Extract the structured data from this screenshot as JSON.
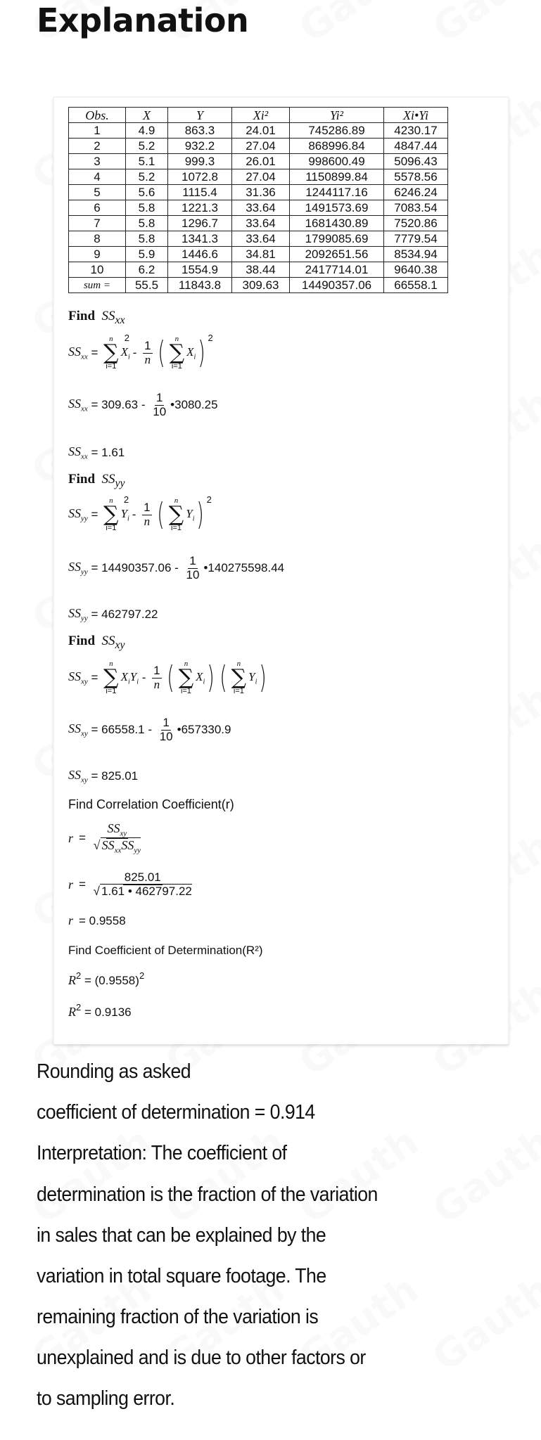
{
  "header": {
    "title": "Explanation"
  },
  "table": {
    "columns": [
      "Obs.",
      "X",
      "Y",
      "Xi²",
      "Yi²",
      "Xi•Yi"
    ],
    "rows": [
      [
        "1",
        "4.9",
        "863.3",
        "24.01",
        "745286.89",
        "4230.17"
      ],
      [
        "2",
        "5.2",
        "932.2",
        "27.04",
        "868996.84",
        "4847.44"
      ],
      [
        "3",
        "5.1",
        "999.3",
        "26.01",
        "998600.49",
        "5096.43"
      ],
      [
        "4",
        "5.2",
        "1072.8",
        "27.04",
        "1150899.84",
        "5578.56"
      ],
      [
        "5",
        "5.6",
        "1115.4",
        "31.36",
        "1244117.16",
        "6246.24"
      ],
      [
        "6",
        "5.8",
        "1221.3",
        "33.64",
        "1491573.69",
        "7083.54"
      ],
      [
        "7",
        "5.8",
        "1296.7",
        "33.64",
        "1681430.89",
        "7520.86"
      ],
      [
        "8",
        "5.8",
        "1341.3",
        "33.64",
        "1799085.69",
        "7779.54"
      ],
      [
        "9",
        "5.9",
        "1446.6",
        "34.81",
        "2092651.56",
        "8534.94"
      ],
      [
        "10",
        "6.2",
        "1554.9",
        "38.44",
        "2417714.01",
        "9640.38"
      ]
    ],
    "sum_row": [
      "sum =",
      "55.5",
      "11843.8",
      "309.63",
      "14490357.06",
      "66558.1"
    ]
  },
  "steps": {
    "ssxx": {
      "find_label": "Find",
      "symbol": "SS",
      "sub": "xx",
      "substitution": {
        "a": "309.63",
        "num": "1",
        "den": "10",
        "b": "•3080.25"
      },
      "result": "1.61"
    },
    "ssyy": {
      "find_label": "Find",
      "symbol": "SS",
      "sub": "yy",
      "substitution": {
        "a": "14490357.06",
        "num": "1",
        "den": "10",
        "b": "•140275598.44"
      },
      "result": "462797.22"
    },
    "ssxy": {
      "find_label": "Find",
      "symbol": "SS",
      "sub": "xy",
      "substitution": {
        "a": "66558.1",
        "num": "1",
        "den": "10",
        "b": "•657330.9"
      },
      "result": "825.01"
    },
    "correlation": {
      "heading": "Find Correlation Coefficient(r)",
      "numerator_value": "825.01",
      "denominator_value": "1.61 • 462797.22",
      "result": "0.9558"
    },
    "determination": {
      "heading": "Find Coefficient of Determination(R²)",
      "square_expr": "(0.9558)",
      "result": "0.9136"
    }
  },
  "summary": {
    "lines": [
      "Rounding as asked",
      "coefficient of determination = 0.914",
      "Interpretation: The coefficient of",
      "determination is the fraction of the variation",
      "in sales that can be explained by the",
      "variation in total square footage. The",
      "remaining fraction of the variation is",
      "unexplained and is due to other factors or",
      "to sampling error."
    ]
  },
  "watermark_text": "Gauth"
}
